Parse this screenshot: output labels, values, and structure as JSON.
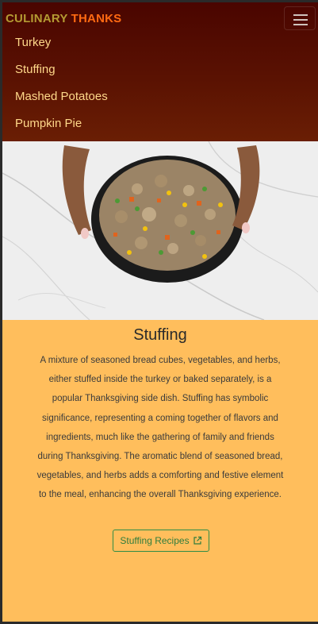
{
  "brand": {
    "word1": "CULINARY",
    "word2": "THANKS"
  },
  "nav": {
    "items": [
      {
        "label": "Turkey"
      },
      {
        "label": "Stuffing"
      },
      {
        "label": "Mashed Potatoes"
      },
      {
        "label": "Pumpkin Pie"
      }
    ]
  },
  "colors": {
    "nav_bg": "#4a0500",
    "page_bg": "#ffbe5c",
    "brand_accent": "#ff6a12",
    "button": "#2f8c46"
  },
  "content": {
    "title": "Stuffing",
    "description": "A mixture of seasoned bread cubes, vegetables, and herbs, either stuffed inside the turkey or baked separately, is a popular Thanksgiving side dish. Stuffing has symbolic significance, representing a coming together of flavors and ingredients, much like the gathering of family and friends during Thanksgiving. The aromatic blend of seasoned bread, vegetables, and herbs adds a comforting and festive element to the meal, enhancing the overall Thanksgiving experience.",
    "button_label": "Stuffing Recipes",
    "button_icon": "external-link-icon"
  },
  "image": {
    "subject": "hands-holding-skillet-of-stuffing-photo"
  }
}
